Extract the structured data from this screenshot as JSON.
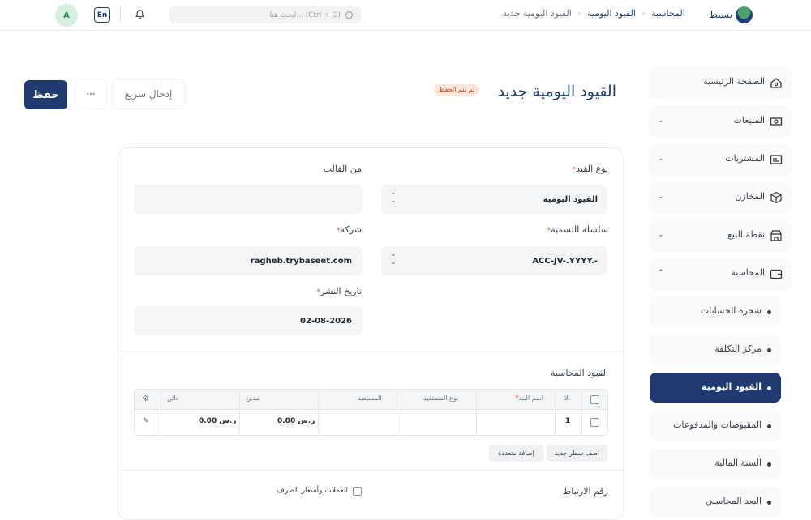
{
  "header": {
    "brand": "بسيط",
    "breadcrumbs": [
      "المحاسبة",
      "القيود اليومية",
      "القيود اليومية جديد"
    ],
    "search_placeholder": "ابحث هنا... (Ctrl + G)",
    "lang_button": "En",
    "avatar_initial": "A"
  },
  "sidebar": {
    "items": [
      {
        "label": "الصفحة الرئيسية",
        "icon": "home-icon"
      },
      {
        "label": "المبيعات",
        "icon": "cash-icon"
      },
      {
        "label": "المشتريات",
        "icon": "receipt-icon"
      },
      {
        "label": "المخازن",
        "icon": "box-icon"
      },
      {
        "label": "نقطة البيع",
        "icon": "store-icon"
      },
      {
        "label": "المحاسبة",
        "icon": "wallet-icon"
      }
    ],
    "sub_items": [
      {
        "label": "شجرة الحسابات"
      },
      {
        "label": "مركز التكلفة"
      },
      {
        "label": "القيود اليومية"
      },
      {
        "label": "المقبوضات والمدفوعات"
      },
      {
        "label": "السنة المالية"
      },
      {
        "label": "البعد المحاسبي"
      }
    ]
  },
  "page": {
    "title": "القيود اليومية جديد",
    "status_badge": "لم يتم الحفظ",
    "quick_entry": "إدخال سريع",
    "more": "···",
    "save": "حفظ"
  },
  "form": {
    "entry_type_label": "نوع القيد",
    "entry_type_value": "القيود اليومية",
    "template_label": "من القالب",
    "template_value": "",
    "naming_series_label": "سلسلة التسمية",
    "naming_series_value": "ACC-JV-.YYYY.-",
    "company_label": "شركة",
    "company_value": "ragheb.trybaseet.com",
    "posting_date_label": "تاريخ النشر",
    "posting_date_value": "02-08-2026"
  },
  "accounts_table": {
    "section_title": "القيود المحاسبة",
    "headers": {
      "no": "لا.",
      "account": "اسم البند",
      "party_type": "نوع المستفيد",
      "party": "المستفيد",
      "debit": "مدين",
      "credit": "دائن"
    },
    "rows": [
      {
        "no": "1",
        "account": "",
        "party_type": "",
        "party": "",
        "debit": "ر.س 0.00",
        "credit": "ر.س 0.00"
      }
    ],
    "add_row": "اضف سطر جديد",
    "add_multiple": "إضافة متعددة"
  },
  "reference": {
    "ref_number_label": "رقم الارتباط",
    "multi_currency_label": "العملات وأسعار الصرف"
  },
  "colors": {
    "primary": "#1e3a6e",
    "badge_bg": "#fde6dc",
    "badge_text": "#d0431a"
  }
}
